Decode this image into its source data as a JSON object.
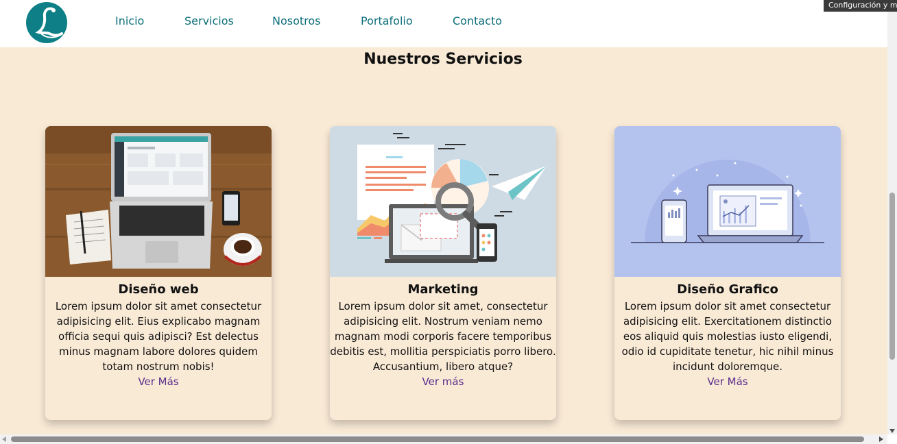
{
  "header": {
    "logo_letter": "L",
    "nav": [
      "Inicio",
      "Servicios",
      "Nosotros",
      "Portafolio",
      "Contacto"
    ]
  },
  "tooltip": "Configuración y más",
  "section": {
    "title": "Nuestros Servicios"
  },
  "cards": [
    {
      "title": "Diseño web",
      "text": "Lorem ipsum dolor sit amet consectetur adipisicing elit. Eius explicabo magnam officia sequi quis adipisci? Est delectus minus magnam labore dolores quidem totam nostrum nobis!",
      "link": "Ver Más",
      "image": "laptop-desk-photo"
    },
    {
      "title": "Marketing",
      "text": "Lorem ipsum dolor sit amet, consectetur adipisicing elit. Nostrum veniam nemo magnam modi corporis facere temporibus debitis est, mollitia perspiciatis porro libero. Accusantium, libero atque?",
      "link": "Ver más",
      "image": "marketing-illustration"
    },
    {
      "title": "Diseño Grafico",
      "text": "Lorem ipsum dolor sit amet consectetur adipisicing elit. Exercitationem distinctio eos aliquid quis molestias iusto eligendi, odio id cupiditate tenetur, hic nihil minus incidunt doloremque.",
      "link": "Ver Más",
      "image": "devices-illustration"
    }
  ],
  "colors": {
    "background": "#f9ead6",
    "nav_text": "#0c6f7a",
    "logo": "#0e7f86",
    "link": "#5a2c8a",
    "card2_bg": "#cfdbe4",
    "card3_bg": "#b4c3ee"
  }
}
